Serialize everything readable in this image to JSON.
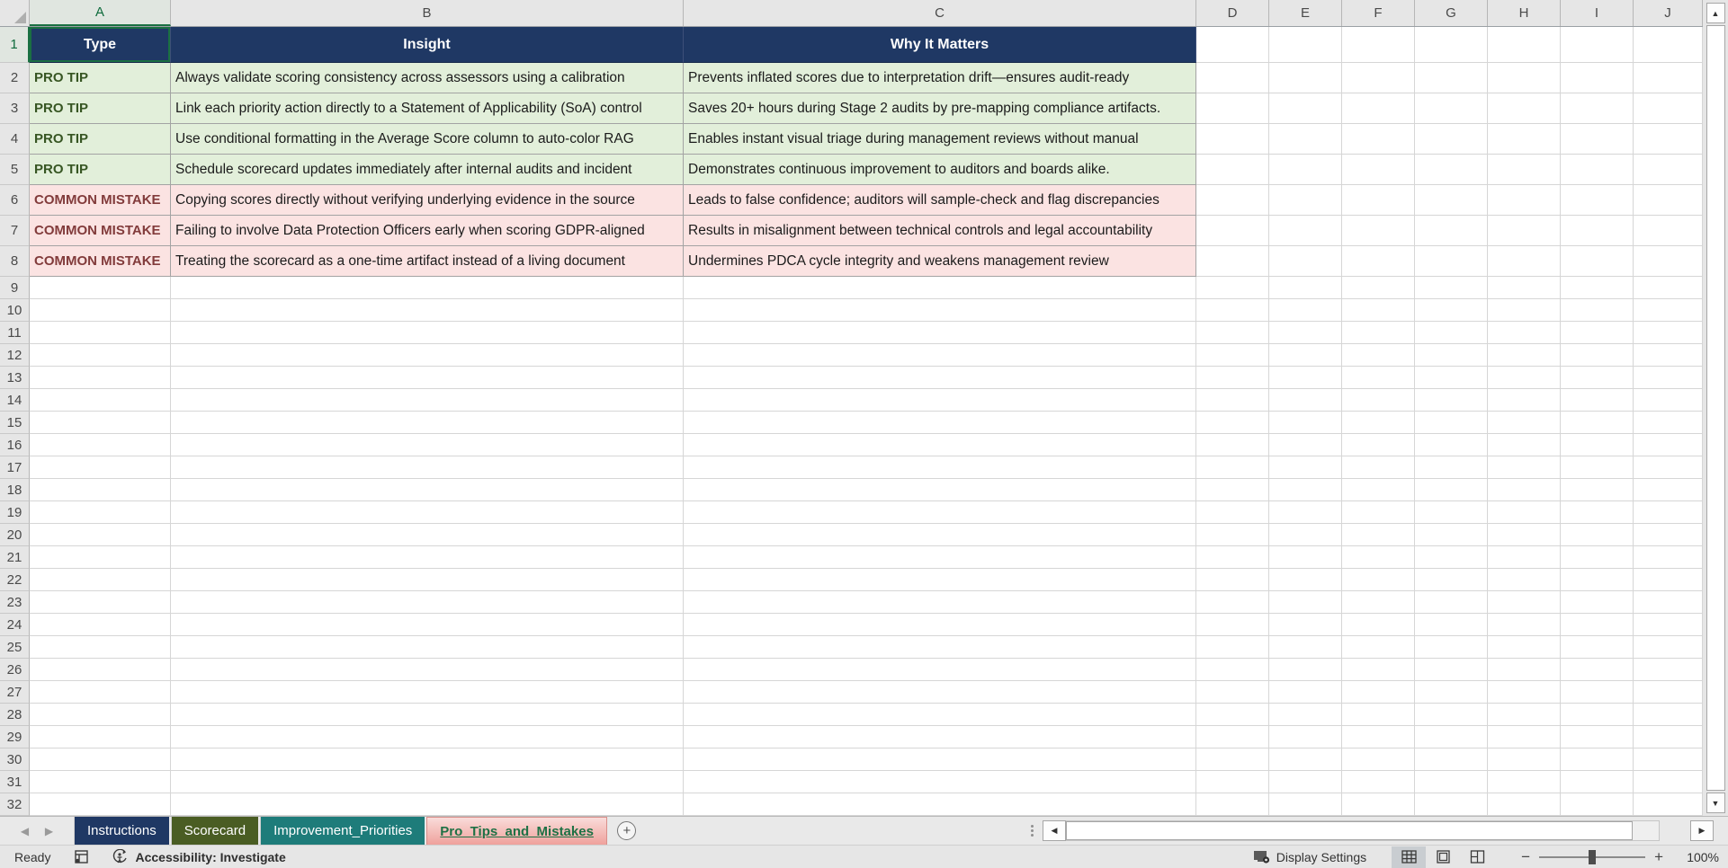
{
  "spreadsheet": {
    "columns": [
      "A",
      "B",
      "C",
      "D",
      "E",
      "F",
      "G",
      "H",
      "I",
      "J"
    ],
    "total_rows": 32,
    "selected_cell": "A1",
    "header": {
      "type": "Type",
      "insight": "Insight",
      "why": "Why It Matters"
    },
    "rows": [
      {
        "kind": "tip",
        "type": "PRO TIP",
        "insight": "Always validate scoring consistency across assessors using a calibration",
        "why": "Prevents inflated scores due to interpretation drift—ensures audit-ready"
      },
      {
        "kind": "tip",
        "type": "PRO TIP",
        "insight": "Link each priority action directly to a Statement of Applicability (SoA) control",
        "why": "Saves 20+ hours during Stage 2 audits by pre-mapping compliance artifacts."
      },
      {
        "kind": "tip",
        "type": "PRO TIP",
        "insight": "Use conditional formatting in the Average Score column to auto-color RAG",
        "why": "Enables instant visual triage during management reviews without manual"
      },
      {
        "kind": "tip",
        "type": "PRO TIP",
        "insight": "Schedule scorecard updates immediately after internal audits and incident",
        "why": "Demonstrates continuous improvement to auditors and boards alike."
      },
      {
        "kind": "mistake",
        "type": "COMMON MISTAKE",
        "insight": "Copying scores directly without verifying underlying evidence in the source",
        "why": "Leads to false confidence; auditors will sample-check and flag discrepancies"
      },
      {
        "kind": "mistake",
        "type": "COMMON MISTAKE",
        "insight": "Failing to involve Data Protection Officers early when scoring GDPR-aligned",
        "why": "Results in misalignment between technical controls and legal accountability"
      },
      {
        "kind": "mistake",
        "type": "COMMON MISTAKE",
        "insight": "Treating the scorecard as a one-time artifact instead of a living document",
        "why": "Undermines PDCA cycle integrity and weakens management review"
      }
    ],
    "colors": {
      "header_bg": "#1F3864",
      "tip_bg": "#E2EFDA",
      "tip_text": "#375623",
      "mistake_bg": "#FBE3E2",
      "mistake_text": "#823B3B",
      "selection_accent": "#1A7042"
    }
  },
  "tabs": [
    {
      "label": "Instructions",
      "color": "#1F3864",
      "active": false
    },
    {
      "label": "Scorecard",
      "color": "#4A5D23",
      "active": false
    },
    {
      "label": "Improvement_Priorities",
      "color": "#1E7C7A",
      "active": false
    },
    {
      "label": "Pro_Tips_and_Mistakes",
      "color": "#EFA19C",
      "active": true
    }
  ],
  "tab_bar": {
    "add_sheet_label": "+"
  },
  "status_bar": {
    "ready_label": "Ready",
    "accessibility_label": "Accessibility: Investigate",
    "display_settings_label": "Display Settings",
    "zoom_percent": "100%",
    "zoom_out_label": "−",
    "zoom_in_label": "+"
  }
}
